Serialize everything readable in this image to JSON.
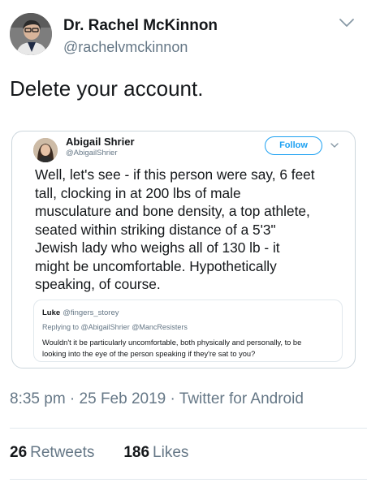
{
  "tweet": {
    "author": {
      "name": "Dr. Rachel McKinnon",
      "handle": "@rachelvmckinnon"
    },
    "text": "Delete your account.",
    "meta": "8:35 pm · 25 Feb 2019 · Twitter for Android",
    "stats": {
      "retweets_count": "26",
      "retweets_label": "Retweets",
      "likes_count": "186",
      "likes_label": "Likes"
    },
    "icons": {
      "menu": "chevron-down-icon"
    }
  },
  "embedded": {
    "author": {
      "name": "Abigail Shrier",
      "handle": "@AbigailShrier"
    },
    "follow_label": "Follow",
    "text_lines": [
      "Well, let's see - if this person were say, 6 feet",
      "tall, clocking in at 200 lbs of  male",
      "musculature and bone density, a top athlete,",
      "seated within striking distance of a 5'3\"",
      "Jewish lady who weighs all of 130 lb - it",
      "might be uncomfortable.  Hypothetically",
      "speaking, of course."
    ],
    "quoted": {
      "name": "Luke",
      "handle": "@fingers_storey",
      "replying_to": "Replying to @AbigailShrier @MancResisters",
      "text_lines": [
        "Wouldn't it be particularly uncomfortable, both physically and personally, to be",
        "looking into the eye of the person speaking if they're sat to you?"
      ]
    }
  },
  "colors": {
    "accent": "#1da1f2",
    "muted": "#657786",
    "border": "#ccd6dd",
    "text": "#14171a"
  }
}
